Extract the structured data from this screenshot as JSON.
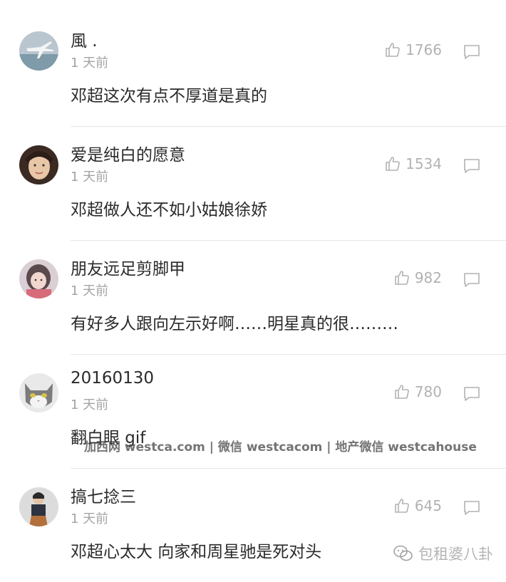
{
  "comments": [
    {
      "username": "風 .",
      "time": "1 天前",
      "likes": "1766",
      "text": "邓超这次有点不厚道是真的",
      "avatar": "airplane-avatar"
    },
    {
      "username": "爱是纯白的愿意",
      "time": "1 天前",
      "likes": "1534",
      "text": "邓超做人还不如小姑娘徐娇",
      "avatar": "woman-avatar"
    },
    {
      "username": "朋友远足剪脚甲",
      "time": "1 天前",
      "likes": "982",
      "text": "有好多人跟向左示好啊……明星真的很………",
      "avatar": "girl-avatar"
    },
    {
      "username": "20160130",
      "time": "1 天前",
      "likes": "780",
      "text": "翻白眼 gif",
      "avatar": "cat-avatar"
    },
    {
      "username": "搞七捻三",
      "time": "1 天前",
      "likes": "645",
      "text": "邓超心太大 向家和周星驰是死对头",
      "avatar": "person-avatar"
    }
  ],
  "watermark": {
    "line": "加西网 westca.com | 微信 westcacom | 地产微信 westcahouse",
    "brand": "包租婆八卦"
  },
  "colors": {
    "text": "#2a2a2a",
    "muted": "#a4a4a4",
    "icon": "#b2b2b2",
    "divider": "#e6e6e6"
  }
}
